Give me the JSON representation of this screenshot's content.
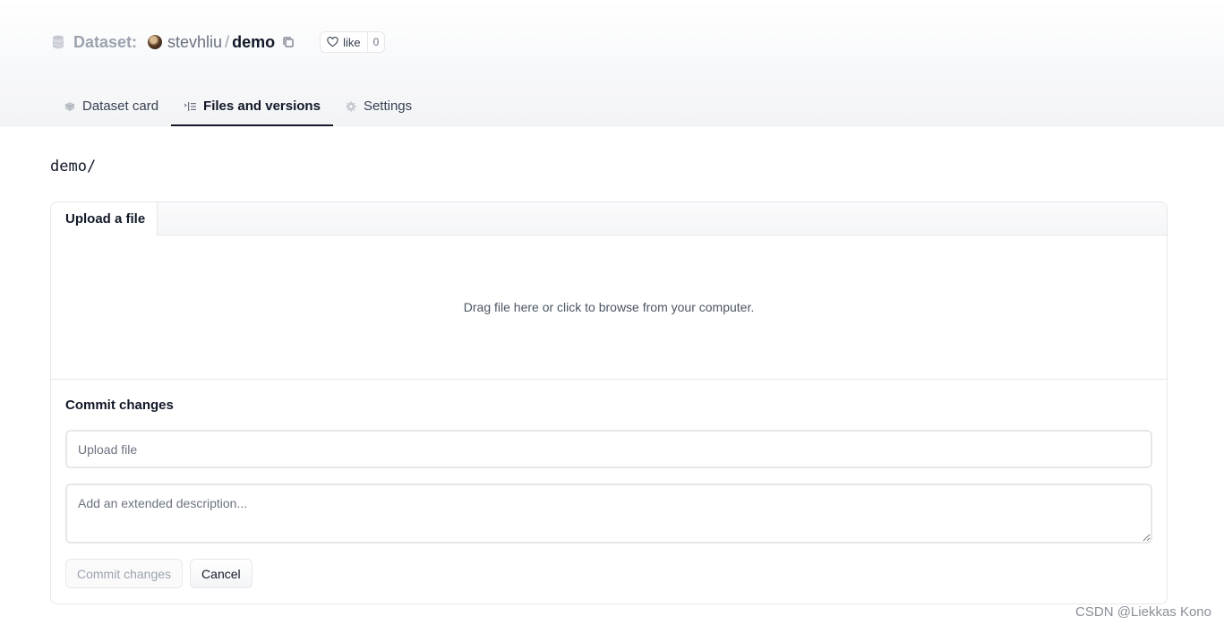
{
  "header": {
    "dataset_label": "Dataset:",
    "owner": "stevhliu",
    "separator": "/",
    "repo_name": "demo",
    "like_label": "like",
    "like_count": "0"
  },
  "tabs": [
    {
      "label": "Dataset card",
      "icon": "dataset-card-icon",
      "active": false
    },
    {
      "label": "Files and versions",
      "icon": "files-icon",
      "active": true
    },
    {
      "label": "Settings",
      "icon": "gear-icon",
      "active": false
    }
  ],
  "path": "demo/",
  "upload_panel": {
    "tab_label": "Upload a file",
    "dropzone_text": "Drag file here or click to browse from your computer."
  },
  "commit": {
    "title": "Commit changes",
    "summary_placeholder": "Upload file",
    "description_placeholder": "Add an extended description...",
    "commit_button": "Commit changes",
    "cancel_button": "Cancel"
  },
  "watermark": "CSDN @Liekkas Kono",
  "colors": {
    "text_primary": "#111827",
    "text_muted": "#9ca3af",
    "border": "#e5e7eb"
  }
}
